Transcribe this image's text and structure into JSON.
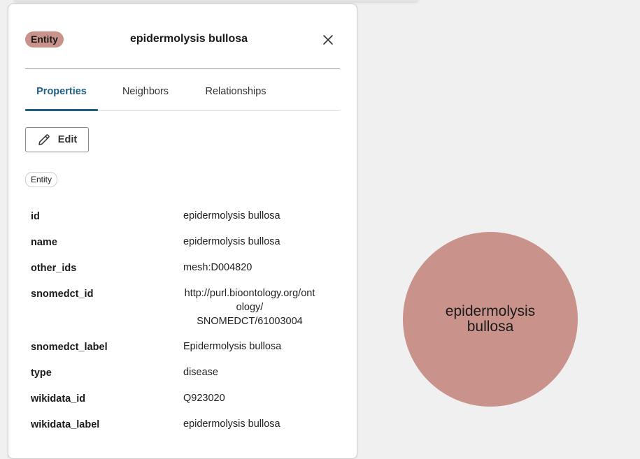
{
  "panel": {
    "badge": "Entity",
    "title": "epidermolysis bullosa",
    "tabs": [
      {
        "label": "Properties"
      },
      {
        "label": "Neighbors"
      },
      {
        "label": "Relationships"
      }
    ],
    "edit_label": "Edit",
    "label_chip": "Entity",
    "properties": [
      {
        "key": "id",
        "value": "epidermolysis bullosa"
      },
      {
        "key": "name",
        "value": "epidermolysis bullosa"
      },
      {
        "key": "other_ids",
        "value": "mesh:D004820"
      },
      {
        "key": "snomedct_id",
        "value": "http://purl.bioontology.org/ontology/SNOMEDCT/61003004"
      },
      {
        "key": "snomedct_label",
        "value": "Epidermolysis bullosa"
      },
      {
        "key": "type",
        "value": "disease"
      },
      {
        "key": "wikidata_id",
        "value": "Q923020"
      },
      {
        "key": "wikidata_label",
        "value": "epidermolysis bullosa"
      }
    ]
  },
  "graph": {
    "node_label": "epidermolysis bullosa",
    "node_color": "#c9928a"
  },
  "colors": {
    "accent": "#1d5f86",
    "entity": "#c9928a"
  }
}
